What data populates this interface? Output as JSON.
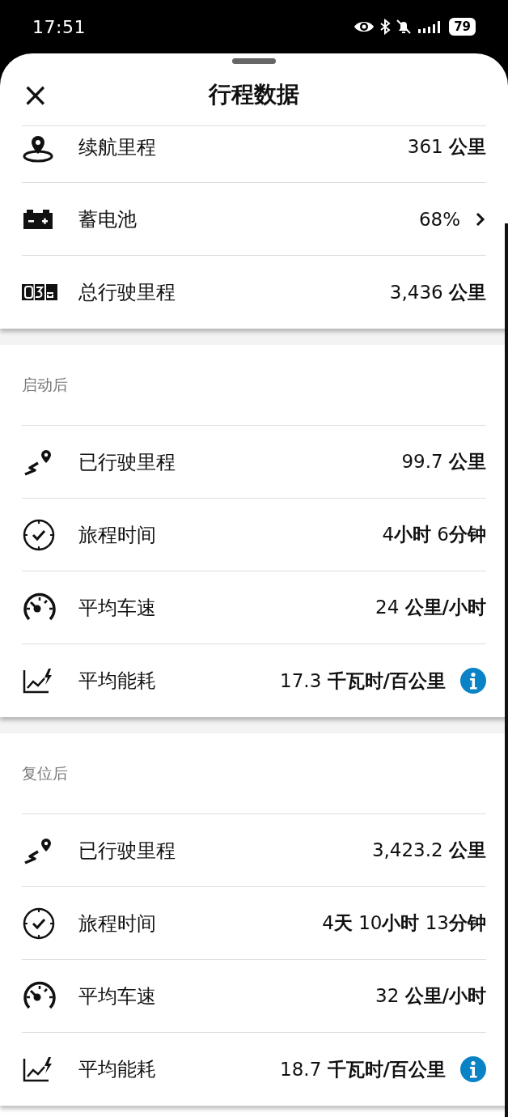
{
  "status_bar": {
    "time": "17:51",
    "battery": "79"
  },
  "header": {
    "title": "行程数据",
    "close": "×"
  },
  "sections": [
    {
      "rows": [
        {
          "kind": "range",
          "label": "续航里程",
          "value": "361 **公里**"
        },
        {
          "kind": "battery",
          "label": "蓄电池",
          "value": "68%"
        },
        {
          "kind": "odometer",
          "label": "总行驶里程",
          "value": "3,436 **公里**"
        }
      ]
    },
    {
      "title": "启动后",
      "rows": [
        {
          "kind": "distance",
          "label": "已行驶里程",
          "value": "99.7 **公里**"
        },
        {
          "kind": "time",
          "label": "旅程时间",
          "value": "4**小时** 6**分钟**"
        },
        {
          "kind": "speed",
          "label": "平均车速",
          "value": "24 **公里/小时**"
        },
        {
          "kind": "consumption",
          "label": "平均能耗",
          "value": "17.3 **千瓦时/百公里**"
        }
      ]
    },
    {
      "title": "复位后",
      "rows": [
        {
          "kind": "distance",
          "label": "已行驶里程",
          "value": "3,423.2 **公里**"
        },
        {
          "kind": "time",
          "label": "旅程时间",
          "value": "4**天** 10**小时** 13**分钟**"
        },
        {
          "kind": "speed",
          "label": "平均车速",
          "value": "32 **公里/小时**"
        },
        {
          "kind": "consumption",
          "label": "平均能耗",
          "value": "18.7 **千瓦时/百公里**"
        }
      ]
    }
  ]
}
